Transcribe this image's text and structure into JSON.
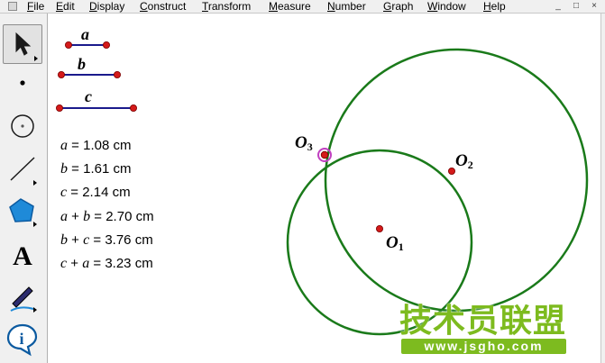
{
  "menubar": {
    "items": [
      {
        "label": "File",
        "key": "F"
      },
      {
        "label": "Edit",
        "key": "E"
      },
      {
        "label": "Display",
        "key": "D"
      },
      {
        "label": "Construct",
        "key": "C"
      },
      {
        "label": "Transform",
        "key": "T"
      },
      {
        "label": "Measure",
        "key": "M"
      },
      {
        "label": "Number",
        "key": "N"
      },
      {
        "label": "Graph",
        "key": "G"
      },
      {
        "label": "Window",
        "key": "W"
      },
      {
        "label": "Help",
        "key": "H"
      }
    ],
    "window_controls": [
      "_",
      "□",
      "×"
    ]
  },
  "toolbar": {
    "tools": [
      {
        "name": "arrow-select-tool",
        "icon": "arrow-icon",
        "active": true
      },
      {
        "name": "point-tool",
        "icon": "point-icon"
      },
      {
        "name": "compass-tool",
        "icon": "compass-circle-icon"
      },
      {
        "name": "straightedge-tool",
        "icon": "line-icon"
      },
      {
        "name": "polygon-tool",
        "icon": "pentagon-icon"
      },
      {
        "name": "text-tool",
        "icon": "letter-a-icon",
        "glyph": "A"
      },
      {
        "name": "marker-tool",
        "icon": "pen-icon"
      },
      {
        "name": "information-tool",
        "icon": "info-icon",
        "glyph": "i"
      }
    ]
  },
  "segments": [
    {
      "label": "a"
    },
    {
      "label": "b"
    },
    {
      "label": "c"
    }
  ],
  "measurements": [
    {
      "expr_var": [
        "a"
      ],
      "op": "",
      "value": "1.08 cm"
    },
    {
      "expr_var": [
        "b"
      ],
      "op": "",
      "value": "1.61 cm"
    },
    {
      "expr_var": [
        "c"
      ],
      "op": "",
      "value": "2.14 cm"
    },
    {
      "expr_var": [
        "a",
        "b"
      ],
      "op": "+",
      "value": "2.70 cm"
    },
    {
      "expr_var": [
        "b",
        "c"
      ],
      "op": "+",
      "value": "3.76 cm"
    },
    {
      "expr_var": [
        "c",
        "a"
      ],
      "op": "+",
      "value": "3.23 cm"
    }
  ],
  "points": [
    {
      "letter": "O",
      "sub": "1"
    },
    {
      "letter": "O",
      "sub": "2"
    },
    {
      "letter": "O",
      "sub": "3"
    }
  ],
  "colors": {
    "circle": "#1a7a1a",
    "segment": "#1a1a8c",
    "point": "#d41a1a",
    "selected_ring": "#c040c0",
    "watermark": "#7dbb1f"
  },
  "watermark": {
    "text": "技术员联盟",
    "url": "www.jsgho.com"
  }
}
